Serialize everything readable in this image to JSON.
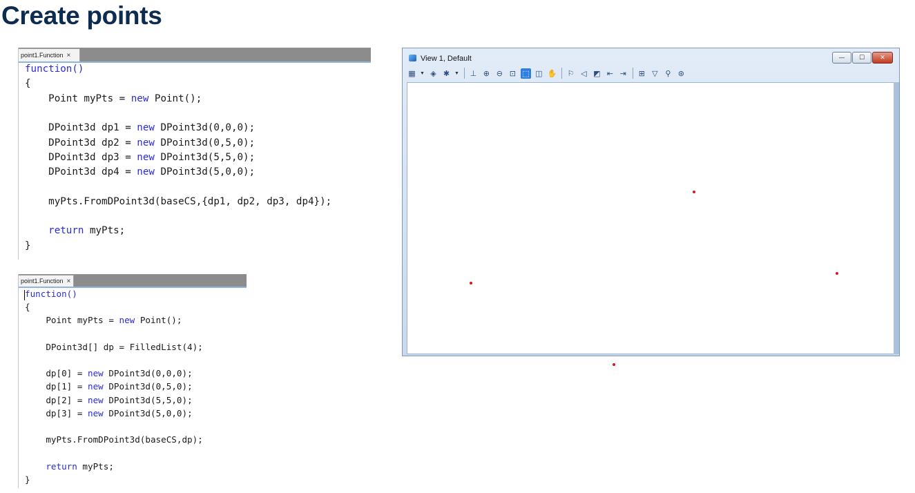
{
  "page": {
    "title": "Create points"
  },
  "editor_top": {
    "tab_label": "point1.Function",
    "close_glyph": "×",
    "lines": [
      [
        {
          "t": "function()",
          "kw": true
        }
      ],
      [
        {
          "t": "{"
        }
      ],
      [
        {
          "t": "    Point myPts = "
        },
        {
          "t": "new",
          "kw": true
        },
        {
          "t": " Point();"
        }
      ],
      [],
      [
        {
          "t": "    DPoint3d dp1 = "
        },
        {
          "t": "new",
          "kw": true
        },
        {
          "t": " DPoint3d(0,0,0);"
        }
      ],
      [
        {
          "t": "    DPoint3d dp2 = "
        },
        {
          "t": "new",
          "kw": true
        },
        {
          "t": " DPoint3d(0,5,0);"
        }
      ],
      [
        {
          "t": "    DPoint3d dp3 = "
        },
        {
          "t": "new",
          "kw": true
        },
        {
          "t": " DPoint3d(5,5,0);"
        }
      ],
      [
        {
          "t": "    DPoint3d dp4 = "
        },
        {
          "t": "new",
          "kw": true
        },
        {
          "t": " DPoint3d(5,0,0);"
        }
      ],
      [],
      [
        {
          "t": "    myPts.FromDPoint3d(baseCS,{dp1, dp2, dp3, dp4});"
        }
      ],
      [],
      [
        {
          "t": "    "
        },
        {
          "t": "return",
          "kw": true
        },
        {
          "t": " myPts;"
        }
      ],
      [
        {
          "t": "}"
        }
      ]
    ]
  },
  "editor_bottom": {
    "tab_label": "point1.Function",
    "close_glyph": "×",
    "lines": [
      [
        {
          "t": "function()",
          "kw": true
        }
      ],
      [
        {
          "t": "{"
        }
      ],
      [
        {
          "t": "    Point myPts = "
        },
        {
          "t": "new",
          "kw": true
        },
        {
          "t": " Point();"
        }
      ],
      [],
      [
        {
          "t": "    DPoint3d[] dp = FilledList(4);"
        }
      ],
      [],
      [
        {
          "t": "    dp[0] = "
        },
        {
          "t": "new",
          "kw": true
        },
        {
          "t": " DPoint3d(0,0,0);"
        }
      ],
      [
        {
          "t": "    dp[1] = "
        },
        {
          "t": "new",
          "kw": true
        },
        {
          "t": " DPoint3d(0,5,0);"
        }
      ],
      [
        {
          "t": "    dp[2] = "
        },
        {
          "t": "new",
          "kw": true
        },
        {
          "t": " DPoint3d(5,5,0);"
        }
      ],
      [
        {
          "t": "    dp[3] = "
        },
        {
          "t": "new",
          "kw": true
        },
        {
          "t": " DPoint3d(5,0,0);"
        }
      ],
      [],
      [
        {
          "t": "    myPts.FromDPoint3d(baseCS,dp);"
        }
      ],
      [],
      [
        {
          "t": "    "
        },
        {
          "t": "return",
          "kw": true
        },
        {
          "t": " myPts;"
        }
      ],
      [
        {
          "t": "}"
        }
      ]
    ]
  },
  "view_window": {
    "title": "View 1, Default",
    "window_buttons": [
      {
        "name": "minimize-button",
        "glyph": "—"
      },
      {
        "name": "maximize-button",
        "glyph": "☐"
      },
      {
        "name": "close-window-button",
        "glyph": "✕"
      }
    ],
    "toolbar_icons": [
      {
        "name": "view-attributes-icon",
        "glyph": "▦",
        "dropdown": true
      },
      {
        "name": "display-style-icon",
        "glyph": "◈",
        "dropdown": false
      },
      {
        "name": "lighting-icon",
        "glyph": "✱",
        "dropdown": true
      },
      {
        "sep": true
      },
      {
        "name": "update-view-icon",
        "glyph": "⊥"
      },
      {
        "name": "zoom-in-icon",
        "glyph": "⊕"
      },
      {
        "name": "zoom-out-icon",
        "glyph": "⊖"
      },
      {
        "name": "window-area-icon",
        "glyph": "⊡"
      },
      {
        "name": "fit-view-icon",
        "glyph": "⬚",
        "active": true
      },
      {
        "name": "rotate-view-icon",
        "glyph": "◫"
      },
      {
        "name": "pan-view-icon",
        "glyph": "✋"
      },
      {
        "sep": true
      },
      {
        "name": "walk-icon",
        "glyph": "⚐"
      },
      {
        "name": "look-icon",
        "glyph": "◁"
      },
      {
        "name": "camera-icon",
        "glyph": "◩"
      },
      {
        "name": "view-previous-icon",
        "glyph": "⇤"
      },
      {
        "name": "view-next-icon",
        "glyph": "⇥"
      },
      {
        "sep": true
      },
      {
        "name": "copy-view-icon",
        "glyph": "⊞"
      },
      {
        "name": "clip-volume-icon",
        "glyph": "▽"
      },
      {
        "name": "clip-mask-icon",
        "glyph": "⚲"
      },
      {
        "name": "view-groups-icon",
        "glyph": "⊛"
      }
    ],
    "points": [
      {
        "x": 0,
        "y": 0
      },
      {
        "x": 0,
        "y": 5
      },
      {
        "x": 5,
        "y": 5
      },
      {
        "x": 5,
        "y": 0
      }
    ],
    "point_color": "#e0141e",
    "accent_color": "#2f7fe0"
  }
}
